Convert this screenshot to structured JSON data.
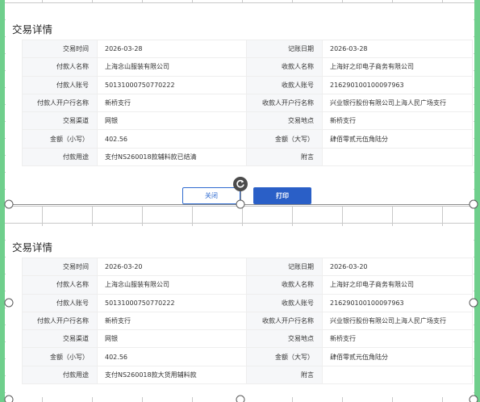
{
  "cards": [
    {
      "title": "交易详情",
      "rows": [
        [
          "交易时间",
          "2026-03-28",
          "记账日期",
          "2026-03-28"
        ],
        [
          "付款人名称",
          "上海念山服装有限公司",
          "收款人名称",
          "上海好之印电子商务有限公司"
        ],
        [
          "付款人账号",
          "50131000750770222",
          "收款人账号",
          "216290100100097963"
        ],
        [
          "付款人开户行名称",
          "新桥支行",
          "收款人开户行名称",
          "兴业银行股份有限公司上海人民广场支行"
        ],
        [
          "交易渠道",
          "网银",
          "交易地点",
          "新桥支行"
        ],
        [
          "金额（小写）",
          "402.56",
          "金额（大写）",
          "肆佰零贰元伍角陆分"
        ],
        [
          "付款用途",
          "支付NS260018款辅料款已结清",
          "附言",
          ""
        ]
      ]
    },
    {
      "title": "交易详情",
      "rows": [
        [
          "交易时间",
          "2026-03-20",
          "记账日期",
          "2026-03-20"
        ],
        [
          "付款人名称",
          "上海念山服装有限公司",
          "收款人名称",
          "上海好之印电子商务有限公司"
        ],
        [
          "付款人账号",
          "50131000750770222",
          "收款人账号",
          "216290100100097963"
        ],
        [
          "付款人开户行名称",
          "新桥支行",
          "收款人开户行名称",
          "兴业银行股份有限公司上海人民广场支行"
        ],
        [
          "交易渠道",
          "网银",
          "交易地点",
          "新桥支行"
        ],
        [
          "金额（小写）",
          "402.56",
          "金额（大写）",
          "肆佰零贰元伍角陆分"
        ],
        [
          "付款用途",
          "支付NS260018款大货用辅料款",
          "附言",
          ""
        ]
      ]
    }
  ],
  "buttons": {
    "close_label": "关闭",
    "print_label": "打印"
  },
  "colors": {
    "accent": "#2a5fc7",
    "sheet_edge": "#6fcf8c"
  }
}
